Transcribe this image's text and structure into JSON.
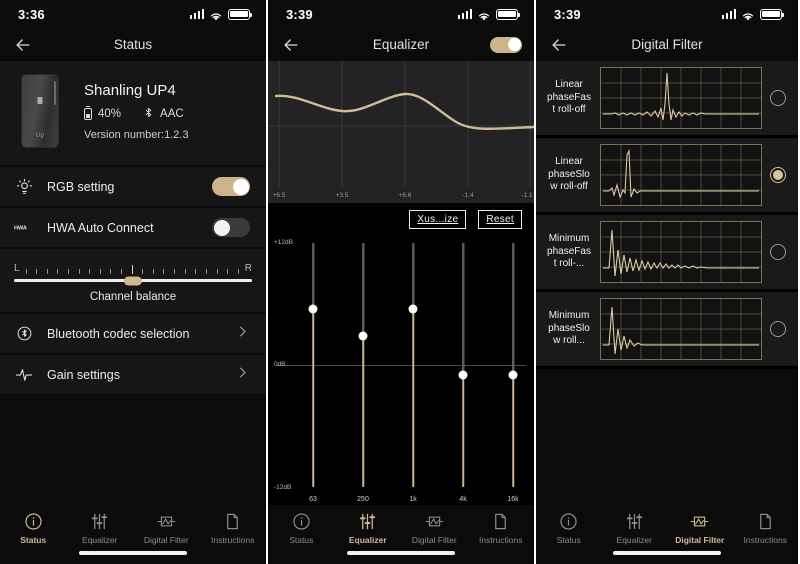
{
  "panels": {
    "status": {
      "statusbar": {
        "time": "3:36",
        "signal_icon": "cellular-signal-icon",
        "wifi_icon": "wifi-icon",
        "battery_icon": "battery-icon"
      },
      "nav": {
        "back_icon": "back-arrow-icon",
        "title": "Status"
      },
      "device": {
        "name": "Shanling UP4",
        "battery_label": "40%",
        "codec_label": "AAC",
        "version_label": "Version number:1.2.3",
        "image_name": "shanling-up4-device-image",
        "device_brand_text": "Up"
      },
      "rows": [
        {
          "icon": "lightbulb-icon",
          "label": "RGB setting",
          "toggle": "on"
        },
        {
          "icon": "hwa-icon",
          "label": "HWA Auto Connect",
          "toggle": "off"
        }
      ],
      "balance": {
        "left_label": "L",
        "right_label": "R",
        "caption": "Channel balance",
        "value_percent": 50
      },
      "links": [
        {
          "icon": "bluetooth-icon",
          "label": "Bluetooth codec selection",
          "chevron": "chevron-right-icon"
        },
        {
          "icon": "gain-wave-icon",
          "label": "Gain settings",
          "chevron": "chevron-right-icon"
        }
      ],
      "tabs": [
        {
          "label": "Status",
          "icon": "info-circle-icon",
          "active": true
        },
        {
          "label": "Equalizer",
          "icon": "sliders-icon",
          "active": false
        },
        {
          "label": "Digital Filter",
          "icon": "filter-chip-icon",
          "active": false
        },
        {
          "label": "Instructions",
          "icon": "document-icon",
          "active": false
        }
      ]
    },
    "equalizer": {
      "statusbar": {
        "time": "3:39",
        "signal_icon": "cellular-signal-icon",
        "wifi_icon": "wifi-icon",
        "battery_icon": "battery-icon"
      },
      "nav": {
        "back_icon": "back-arrow-icon",
        "title": "Equalizer",
        "toggle": "on"
      },
      "buttons": {
        "customize": "Xus...ize",
        "reset": "Reset"
      },
      "scale": {
        "top": "+12dB",
        "mid": "0dB",
        "bottom": "-12dB"
      },
      "tabs": [
        {
          "label": "Status",
          "icon": "info-circle-icon",
          "active": false
        },
        {
          "label": "Equalizer",
          "icon": "sliders-icon",
          "active": true
        },
        {
          "label": "Digital Filter",
          "icon": "filter-chip-icon",
          "active": false
        },
        {
          "label": "Instructions",
          "icon": "document-icon",
          "active": false
        }
      ]
    },
    "digital_filter": {
      "statusbar": {
        "time": "3:39",
        "signal_icon": "cellular-signal-icon",
        "wifi_icon": "wifi-icon",
        "battery_icon": "battery-icon"
      },
      "nav": {
        "back_icon": "back-arrow-icon",
        "title": "Digital Filter"
      },
      "filters": [
        {
          "label": "Linear phaseFast roll-off",
          "selected": false,
          "plot": "linear-phase-fast-rolloff-impulse"
        },
        {
          "label": "Linear phaseSlow roll-off",
          "selected": true,
          "plot": "linear-phase-slow-rolloff-impulse"
        },
        {
          "label": "Minimum phaseFast roll-...",
          "selected": false,
          "plot": "minimum-phase-fast-rolloff-impulse"
        },
        {
          "label": "Minimum phaseSlow roll...",
          "selected": false,
          "plot": "minimum-phase-slow-rolloff-impulse"
        }
      ],
      "tabs": [
        {
          "label": "Status",
          "icon": "info-circle-icon",
          "active": false
        },
        {
          "label": "Equalizer",
          "icon": "sliders-icon",
          "active": false
        },
        {
          "label": "Digital Filter",
          "icon": "filter-chip-icon",
          "active": true
        },
        {
          "label": "Instructions",
          "icon": "document-icon",
          "active": false
        }
      ]
    }
  },
  "chart_data": [
    {
      "type": "line",
      "title": "Equalizer response curve",
      "xlabel": "",
      "ylabel": "dB",
      "x": [
        0,
        1,
        2,
        3,
        4
      ],
      "tick_labels": [
        "+6.5",
        "+3.5",
        "+6.6",
        "-1.4",
        "-1.1"
      ],
      "values": [
        6.5,
        3.5,
        6.6,
        -1.4,
        -1.1
      ],
      "ylim": [
        -12,
        12
      ],
      "grid": true,
      "legend": "none"
    },
    {
      "type": "bar",
      "title": "Equalizer band gains",
      "categories": [
        "63",
        "250",
        "1k",
        "4k",
        "16k"
      ],
      "values": [
        5.5,
        3.2,
        5.5,
        -0.8,
        -0.8
      ],
      "ylabel": "dB",
      "ylim": [
        -12,
        12
      ],
      "grid": false,
      "legend": "none"
    }
  ],
  "colors": {
    "accent_gold": "#cbb489",
    "background": "#0b0b0b",
    "card": "#161616",
    "text_primary": "#f2f2f2",
    "text_muted": "#8d8d8d",
    "plot_line": "#cdbd97"
  }
}
